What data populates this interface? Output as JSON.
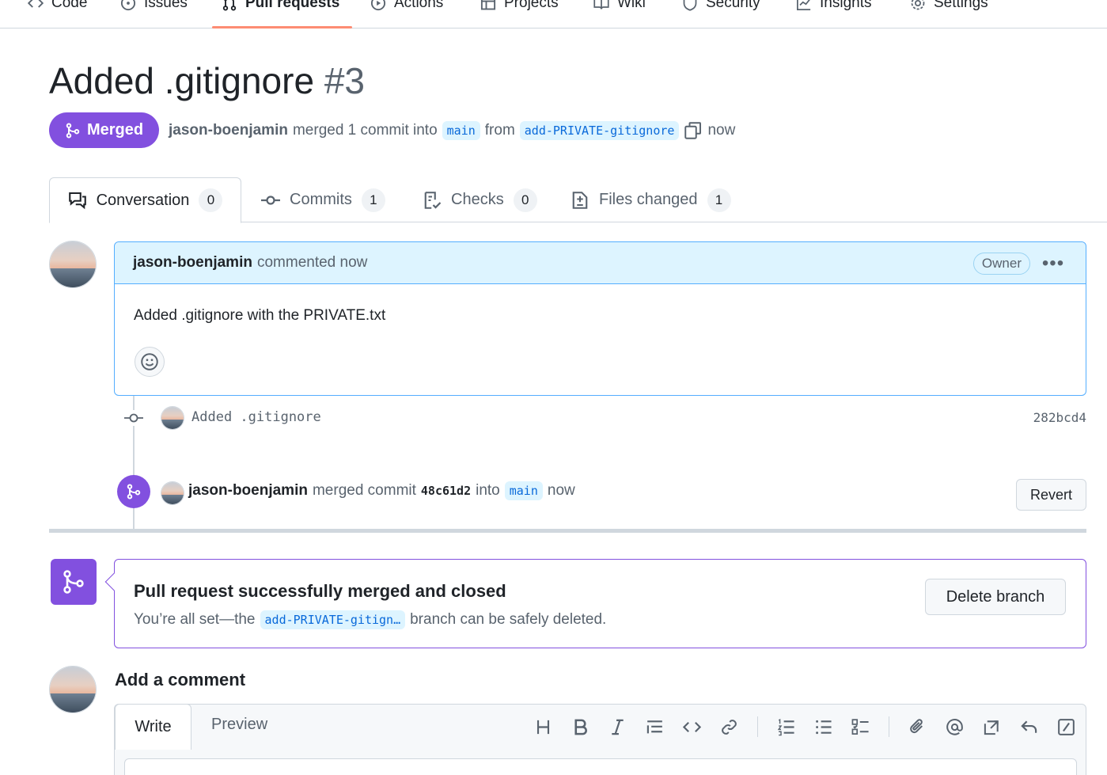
{
  "repo_nav": {
    "items": [
      {
        "label": "Code",
        "icon": "code-icon"
      },
      {
        "label": "Issues",
        "icon": "issue-icon"
      },
      {
        "label": "Pull requests",
        "icon": "pull-request-icon",
        "active": true
      },
      {
        "label": "Actions",
        "icon": "play-icon"
      },
      {
        "label": "Projects",
        "icon": "table-icon"
      },
      {
        "label": "Wiki",
        "icon": "book-icon"
      },
      {
        "label": "Security",
        "icon": "shield-icon"
      },
      {
        "label": "Insights",
        "icon": "graph-icon"
      },
      {
        "label": "Settings",
        "icon": "gear-icon"
      }
    ]
  },
  "pr": {
    "title": "Added .gitignore",
    "number": "#3",
    "state": "Merged",
    "author": "jason-boenjamin",
    "merged_text": "merged 1 commit into",
    "base_branch": "main",
    "from_text": "from",
    "head_branch": "add-PRIVATE-gitignore",
    "time": "now"
  },
  "tabs": [
    {
      "label": "Conversation",
      "count": "0",
      "icon": "comment-discussion-icon"
    },
    {
      "label": "Commits",
      "count": "1",
      "icon": "commit-icon"
    },
    {
      "label": "Checks",
      "count": "0",
      "icon": "checklist-icon"
    },
    {
      "label": "Files changed",
      "count": "1",
      "icon": "file-diff-icon"
    }
  ],
  "comment": {
    "author": "jason-boenjamin",
    "action": "commented now",
    "role": "Owner",
    "more": "•••",
    "body": "Added .gitignore with the PRIVATE.txt"
  },
  "commit": {
    "message": "Added .gitignore",
    "sha": "282bcd4"
  },
  "merge_event": {
    "author": "jason-boenjamin",
    "text": "merged commit",
    "sha": "48c61d2",
    "into": "into",
    "branch": "main",
    "time": "now",
    "revert_label": "Revert"
  },
  "merge_status": {
    "title": "Pull request successfully merged and closed",
    "sub_before": "You’re all set—the",
    "branch": "add-PRIVATE-gitign…",
    "sub_after": "branch can be safely deleted.",
    "delete_label": "Delete branch"
  },
  "add_comment": {
    "title": "Add a comment",
    "write_tab": "Write",
    "preview_tab": "Preview"
  },
  "colors": {
    "merged_purple": "#8250df",
    "tab_underline": "#fd8c73",
    "comment_header": "#ddf4ff",
    "link_blue": "#0969da"
  }
}
